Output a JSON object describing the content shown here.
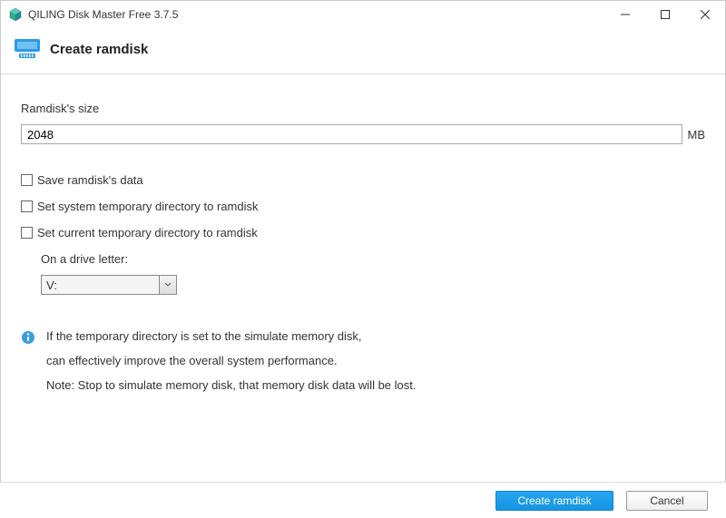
{
  "window": {
    "title": "QILING Disk Master Free 3.7.5"
  },
  "header": {
    "title": "Create ramdisk"
  },
  "ramdisk": {
    "size_label": "Ramdisk's size",
    "size_value": "2048",
    "size_unit": "MB"
  },
  "options": {
    "save_data": {
      "label": "Save ramdisk's data",
      "checked": false
    },
    "set_system_temp": {
      "label": "Set system temporary directory to ramdisk",
      "checked": false
    },
    "set_current_temp": {
      "label": "Set current temporary directory to ramdisk",
      "checked": false
    }
  },
  "drive": {
    "label": "On a drive letter:",
    "selected": "V:"
  },
  "info": {
    "line1": "If the temporary directory is set to the simulate memory disk,",
    "line2": "can effectively improve the overall system performance.",
    "line3": "Note: Stop to simulate memory disk, that memory disk data will be lost."
  },
  "footer": {
    "primary": "Create ramdisk",
    "cancel": "Cancel"
  }
}
